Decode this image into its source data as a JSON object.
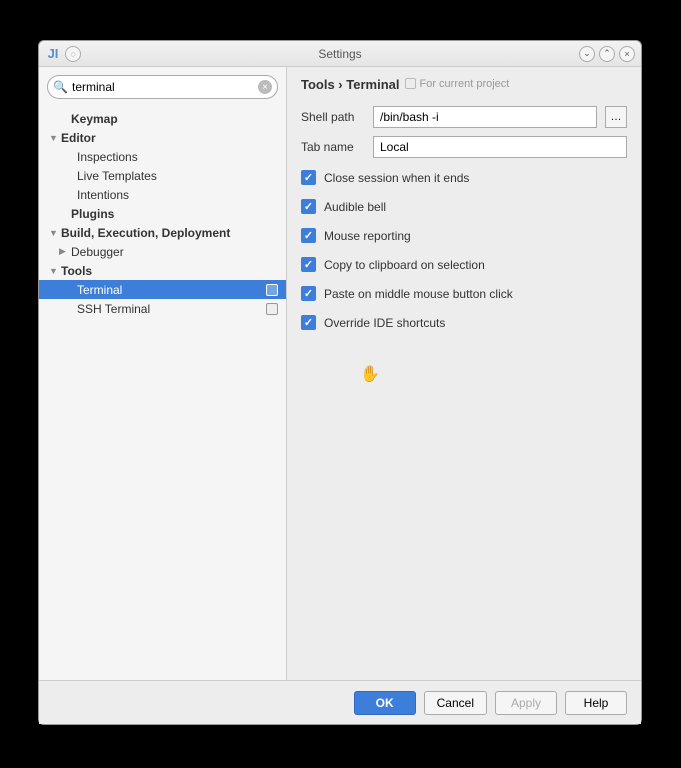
{
  "window": {
    "title": "Settings"
  },
  "search": {
    "value": "terminal",
    "placeholder": ""
  },
  "tree": {
    "keymap": "Keymap",
    "editor": "Editor",
    "inspections": "Inspections",
    "live_templates": "Live Templates",
    "intentions": "Intentions",
    "plugins": "Plugins",
    "build": "Build, Execution, Deployment",
    "debugger": "Debugger",
    "tools": "Tools",
    "terminal": "Terminal",
    "ssh_terminal": "SSH Terminal"
  },
  "breadcrumb": {
    "path": "Tools › Terminal",
    "note": "For current project"
  },
  "form": {
    "shell_path_label": "Shell path",
    "shell_path_value": "/bin/bash -i",
    "tab_name_label": "Tab name",
    "tab_name_value": "Local"
  },
  "checks": {
    "close_session": "Close session when it ends",
    "audible_bell": "Audible bell",
    "mouse_reporting": "Mouse reporting",
    "copy_clipboard": "Copy to clipboard on selection",
    "paste_middle": "Paste on middle mouse button click",
    "override_shortcuts": "Override IDE shortcuts"
  },
  "buttons": {
    "ok": "OK",
    "cancel": "Cancel",
    "apply": "Apply",
    "help": "Help"
  }
}
